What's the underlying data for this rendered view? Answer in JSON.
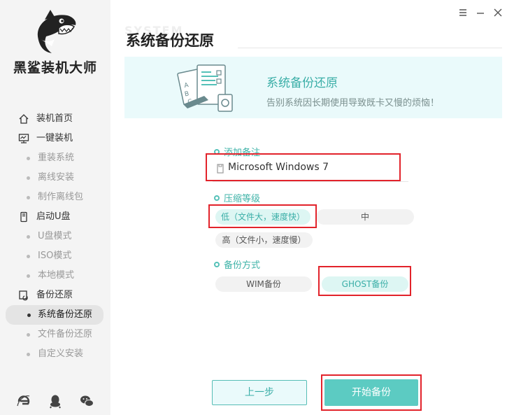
{
  "app": {
    "brand": "黑鲨装机大师"
  },
  "window_controls": {
    "menu_icon": "menu-icon",
    "minimize_icon": "minimize-icon",
    "close_icon": "close-icon"
  },
  "sidebar": {
    "groups": [
      {
        "label": "装机首页",
        "icon": "home-icon"
      },
      {
        "label": "一键装机",
        "icon": "monitor-icon",
        "subs": [
          "重装系统",
          "离线安装",
          "制作离线包"
        ]
      },
      {
        "label": "启动U盘",
        "icon": "usb-icon",
        "subs": [
          "U盘模式",
          "ISO模式",
          "本地模式"
        ]
      },
      {
        "label": "备份还原",
        "icon": "restore-icon",
        "subs": [
          "系统备份还原",
          "文件备份还原",
          "自定义安装"
        ],
        "active_sub": "系统备份还原"
      }
    ],
    "social": [
      "ie-icon",
      "qq-icon",
      "wechat-icon"
    ]
  },
  "header": {
    "watermark": "SYSTEM",
    "title": "系统备份还原"
  },
  "banner": {
    "title": "系统备份还原",
    "subtitle": "告别系统因长期使用导致既卡又慢的烦恼！"
  },
  "form": {
    "note_label": "添加备注",
    "note_value": "Microsoft Windows 7",
    "compress_label": "压缩等级",
    "compress_options": [
      "低（文件大，速度快）",
      "中",
      "高（文件小，速度慢）"
    ],
    "compress_selected": "低（文件大，速度快）",
    "method_label": "备份方式",
    "method_options": [
      "WIM备份",
      "GHOST备份"
    ],
    "method_selected": "GHOST备份"
  },
  "footer": {
    "prev_label": "上一步",
    "start_label": "开始备份"
  },
  "colors": {
    "accent": "#5ccbc2",
    "accent_text": "#3aaea7",
    "highlight_box": "#e2232b",
    "sidebar_bg": "#f4f4f4"
  }
}
